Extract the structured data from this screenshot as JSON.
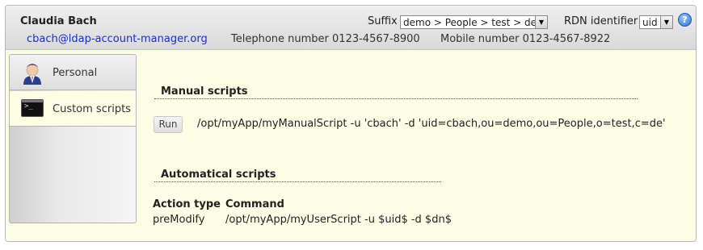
{
  "header": {
    "user_name": "Claudia Bach",
    "email": "cbach@ldap-account-manager.org",
    "telephone": "Telephone number 0123-4567-8900",
    "mobile": "Mobile number 0123-4567-8922",
    "suffix_label": "Suffix",
    "suffix_value": "demo > People > test > de",
    "rdn_label": "RDN identifier",
    "rdn_value": "uid",
    "help_icon": "help-icon"
  },
  "tabs": [
    {
      "label": "Personal",
      "icon": "person-avatar-icon",
      "active": false
    },
    {
      "label": "Custom scripts",
      "icon": "terminal-icon",
      "active": true
    }
  ],
  "manual": {
    "title": "Manual scripts",
    "run_label": "Run",
    "command": "/opt/myApp/myManualScript -u 'cbach' -d 'uid=cbach,ou=demo,ou=People,o=test,c=de'"
  },
  "automatic": {
    "title": "Automatical scripts",
    "headers": {
      "action_type": "Action type",
      "command": "Command"
    },
    "rows": [
      {
        "action_type": "preModify",
        "command": "/opt/myApp/myUserScript -u $uid$ -d $dn$"
      }
    ]
  }
}
